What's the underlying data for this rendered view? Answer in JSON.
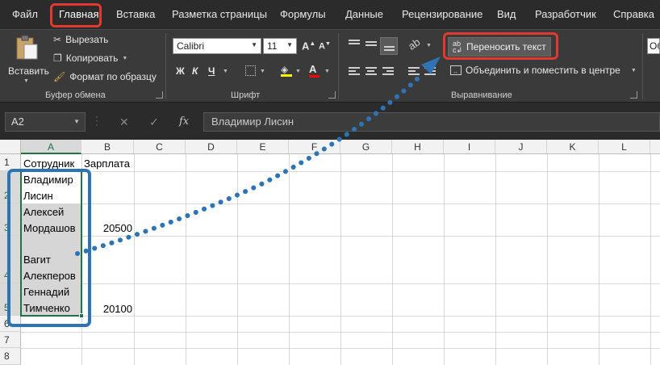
{
  "menu_tabs": [
    "Файл",
    "Главная",
    "Вставка",
    "Разметка страницы",
    "Формулы",
    "Данные",
    "Рецензирование",
    "Вид",
    "Разработчик",
    "Справка"
  ],
  "active_tab": "Главная",
  "clipboard": {
    "paste_label": "Вставить",
    "cut_label": "Вырезать",
    "copy_label": "Копировать",
    "format_painter_label": "Формат по образцу",
    "group_label": "Буфер обмена"
  },
  "font": {
    "name": "Calibri",
    "size": "11",
    "bold": "Ж",
    "italic": "К",
    "underline": "Ч",
    "color_letter": "А",
    "group_label": "Шрифт"
  },
  "alignment": {
    "wrap_text_label": "Переносить текст",
    "merge_center_label": "Объединить и поместить в центре",
    "group_label": "Выравнивание"
  },
  "overflow_label": "Об",
  "formula_bar": {
    "name_box": "A2",
    "fx": "fx",
    "value": "Владимир Лисин"
  },
  "sheet": {
    "columns": [
      "A",
      "B",
      "C",
      "D",
      "E",
      "F",
      "G",
      "H",
      "I",
      "J",
      "K",
      "L"
    ],
    "rows": [
      "1",
      "2",
      "3",
      "4",
      "5",
      "6",
      "7",
      "8"
    ],
    "header_a": "Сотрудник",
    "header_b": "Зарплата",
    "employees": [
      {
        "line1": "Владимир",
        "line2": "Лисин",
        "salary": ""
      },
      {
        "line1": "Алексей",
        "line2": "Мордашов",
        "salary": "20500"
      },
      {
        "line1": "Вагит",
        "line2": "Алекперов",
        "salary": ""
      },
      {
        "line1": "Геннадий",
        "line2": "Тимченко",
        "salary": "20100"
      }
    ]
  },
  "colors": {
    "accent_green": "#217346",
    "highlight_red": "#e0392f",
    "highlight_blue": "#2e74b5"
  }
}
